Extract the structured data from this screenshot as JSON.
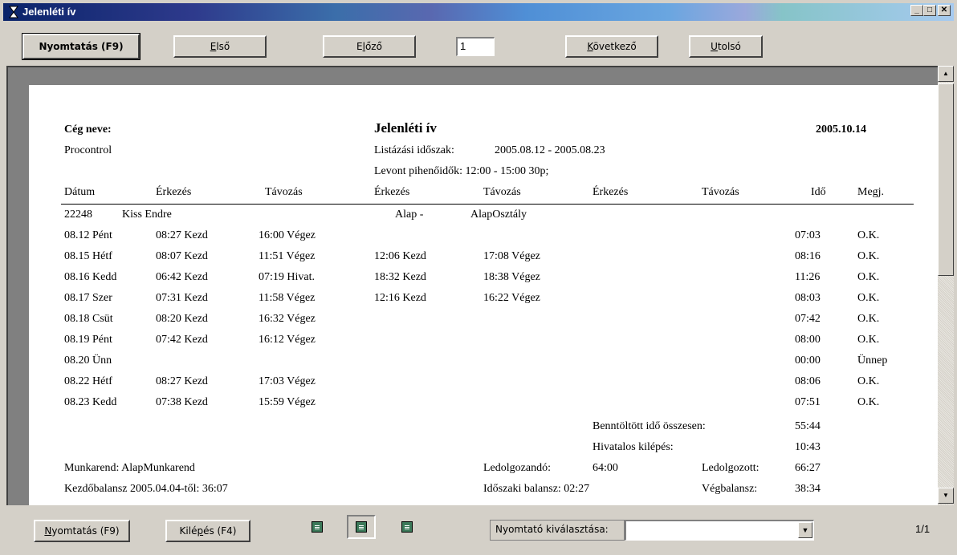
{
  "window": {
    "title": "Jelenléti ív"
  },
  "toolbar": {
    "print_label": "Nyomtatás (F9)",
    "first": {
      "u": "E",
      "rest": "lső"
    },
    "prev": {
      "pre": "E",
      "u": "l",
      "rest": "őző"
    },
    "page_value": "1",
    "next": {
      "u": "K",
      "rest": "övetkező"
    },
    "last": {
      "u": "U",
      "rest": "tolsó"
    }
  },
  "report": {
    "company_label": "Cég neve:",
    "company": "Procontrol",
    "title": "Jelenléti ív",
    "date": "2005.10.14",
    "period_label": "Listázási időszak:",
    "period": "2005.08.12 - 2005.08.23",
    "breaks": "Levont pihenőidők: 12:00 - 15:00 30p;",
    "columns": [
      "Dátum",
      "Érkezés",
      "Távozás",
      "Érkezés",
      "Távozás",
      "Érkezés",
      "Távozás",
      "Idő",
      "Megj."
    ],
    "employee": {
      "id": "22248",
      "name": "Kiss Endre",
      "group": "Alap -",
      "dept": "AlapOsztály"
    },
    "rows": [
      {
        "date": "08.12 Pént",
        "a1": "08:27 Kezd",
        "d1": "16:00 Végez",
        "a2": "",
        "d2": "",
        "time": "07:03",
        "note": "O.K."
      },
      {
        "date": "08.15 Hétf",
        "a1": "08:07 Kezd",
        "d1": "11:51 Végez",
        "a2": "12:06 Kezd",
        "d2": "17:08 Végez",
        "time": "08:16",
        "note": "O.K."
      },
      {
        "date": "08.16 Kedd",
        "a1": "06:42 Kezd",
        "d1": "07:19 Hivat.",
        "a2": "18:32 Kezd",
        "d2": "18:38 Végez",
        "time": "11:26",
        "note": "O.K."
      },
      {
        "date": "08.17 Szer",
        "a1": "07:31 Kezd",
        "d1": "11:58 Végez",
        "a2": "12:16 Kezd",
        "d2": "16:22 Végez",
        "time": "08:03",
        "note": "O.K."
      },
      {
        "date": "08.18 Csüt",
        "a1": "08:20 Kezd",
        "d1": "16:32 Végez",
        "a2": "",
        "d2": "",
        "time": "07:42",
        "note": "O.K."
      },
      {
        "date": "08.19 Pént",
        "a1": "07:42 Kezd",
        "d1": "16:12 Végez",
        "a2": "",
        "d2": "",
        "time": "08:00",
        "note": "O.K."
      },
      {
        "date": "08.20 Ünn",
        "a1": "",
        "d1": "",
        "a2": "",
        "d2": "",
        "time": "00:00",
        "note": "Ünnep"
      },
      {
        "date": "08.22 Hétf",
        "a1": "08:27 Kezd",
        "d1": "17:03 Végez",
        "a2": "",
        "d2": "",
        "time": "08:06",
        "note": "O.K."
      },
      {
        "date": "08.23 Kedd",
        "a1": "07:38 Kezd",
        "d1": "15:59 Végez",
        "a2": "",
        "d2": "",
        "time": "07:51",
        "note": "O.K."
      }
    ],
    "summary": {
      "filled_label": "Benntöltött idő összesen:",
      "filled_value": "55:44",
      "exit_label": "Hivatalos kilépés:",
      "exit_value": "10:43",
      "schedule": "Munkarend: AlapMunkarend",
      "to_work_label": "Ledolgozandó:",
      "to_work_value": "64:00",
      "worked_label": "Ledolgozott:",
      "worked_value": "66:27",
      "start_balance": "Kezdőbalansz 2005.04.04-től: 36:07",
      "period_balance": "Időszaki balansz: 02:27",
      "end_balance_label": "Végbalansz:",
      "end_balance_value": "38:34"
    }
  },
  "bottom": {
    "print": {
      "u": "N",
      "rest": "yomtatás (F9)"
    },
    "exit": {
      "pre": "Kilé",
      "u": "p",
      "rest": "és (F4)"
    },
    "printer_label": "Nyomtató kiválasztása:",
    "printer_value": "",
    "page_count": "1/1"
  }
}
